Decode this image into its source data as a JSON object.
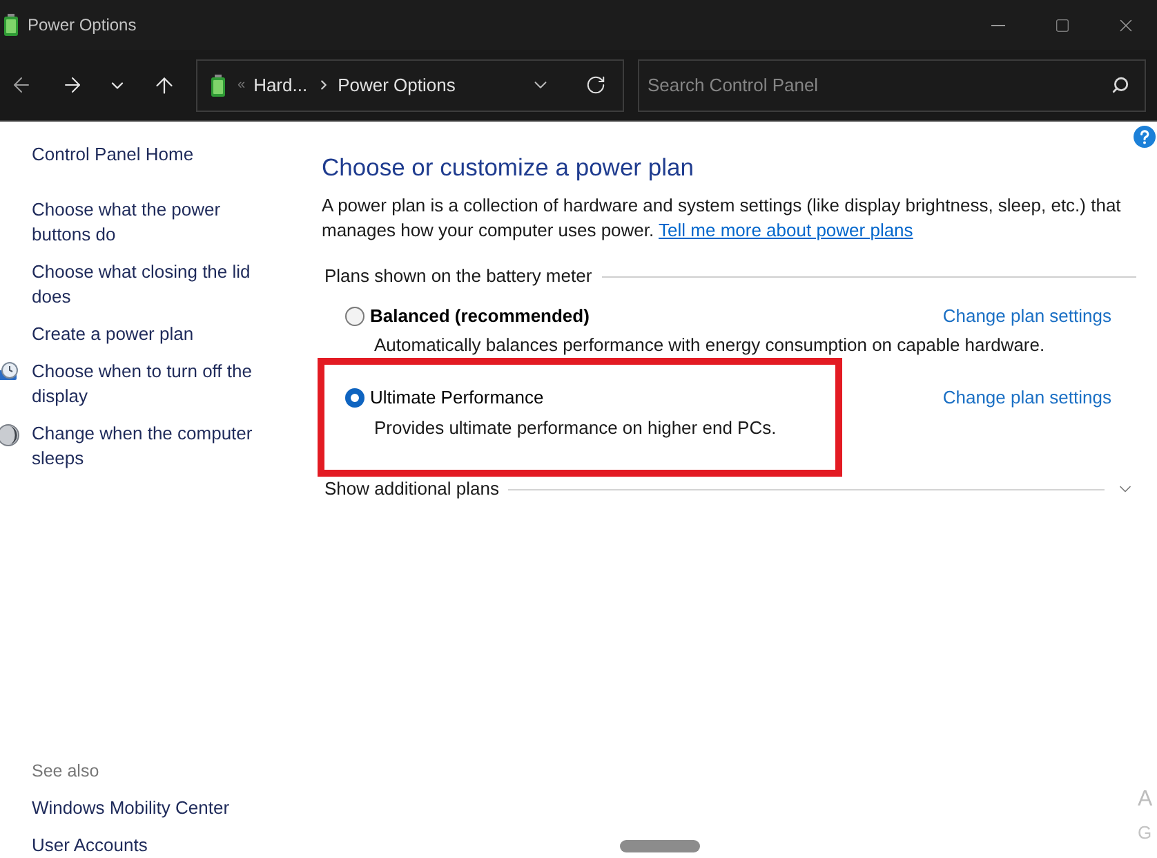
{
  "window": {
    "title": "Power Options"
  },
  "address_bar": {
    "overflow_marker": "«",
    "breadcrumb": [
      "Hard...",
      "Power Options"
    ]
  },
  "search": {
    "placeholder": "Search Control Panel"
  },
  "sidebar": {
    "items": [
      {
        "label": "Control Panel Home",
        "kind": "text"
      },
      {
        "label": "Choose what the power buttons do",
        "kind": "text"
      },
      {
        "label": "Choose what closing the lid does",
        "kind": "text"
      },
      {
        "label": "Create a power plan",
        "kind": "text"
      },
      {
        "label": "Choose when to turn off the display",
        "kind": "clock"
      },
      {
        "label": "Change when the computer sleeps",
        "kind": "moon"
      }
    ],
    "see_also": {
      "title": "See also",
      "items": [
        "Windows Mobility Center",
        "User Accounts"
      ]
    }
  },
  "main": {
    "heading": "Choose or customize a power plan",
    "intro": "A power plan is a collection of hardware and system settings (like display brightness, sleep, etc.) that manages how your computer uses power.",
    "intro_link": "Tell me more about power plans",
    "group_label": "Plans shown on the battery meter",
    "plans": [
      {
        "name": "Balanced (recommended)",
        "emphasized": true,
        "description": "Automatically balances performance with energy consumption on capable hardware.",
        "link": "Change plan settings",
        "selected": false,
        "highlighted": false
      },
      {
        "name": "Ultimate Performance",
        "emphasized": false,
        "description": "Provides ultimate performance on higher end PCs.",
        "link": "Change plan settings",
        "selected": true,
        "highlighted": true
      }
    ],
    "more_plans": {
      "label": "Show additional plans",
      "expanded": false
    }
  },
  "activation_notice": [
    "A",
    "G"
  ]
}
